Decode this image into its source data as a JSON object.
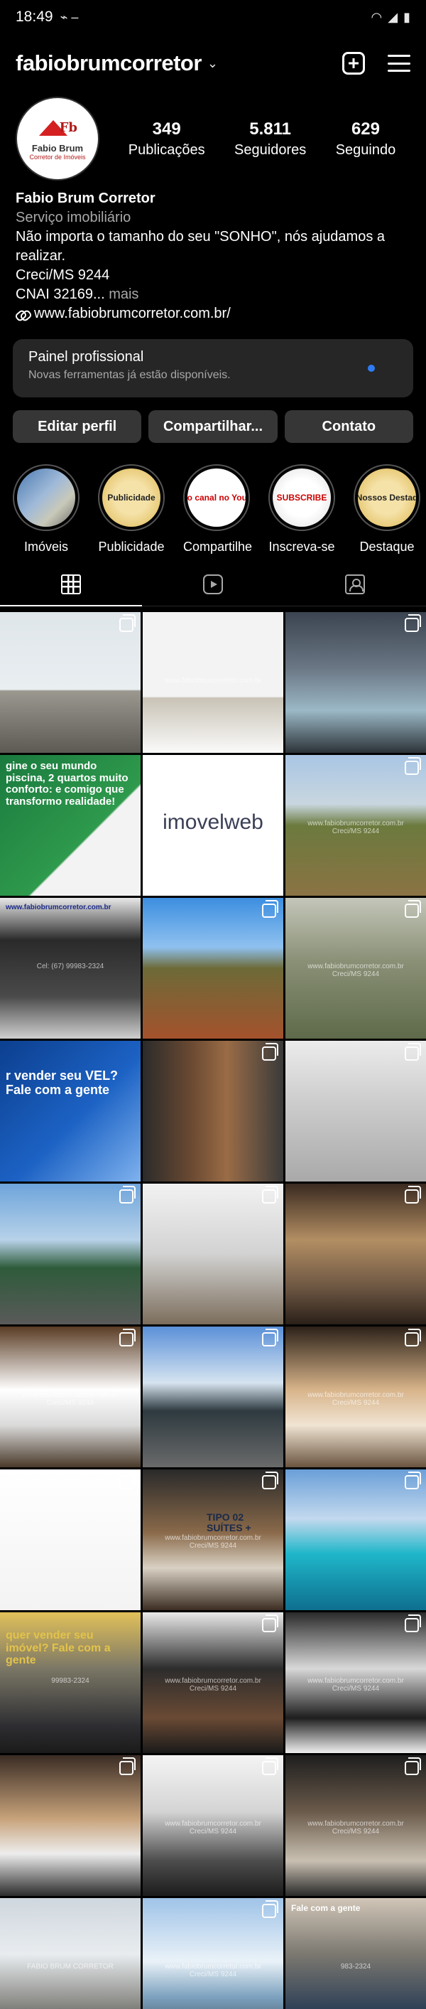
{
  "status_bar": {
    "time": "18:49",
    "indicators": "⌁ –",
    "signal": "wifi-signal-battery"
  },
  "header": {
    "username": "fabiobrumcorretor"
  },
  "profile": {
    "avatar_title": "Fabio Brum",
    "avatar_subtitle": "Corretor de Imóveis",
    "avatar_mark": "Fb",
    "stats": [
      {
        "value": "349",
        "label": "Publicações"
      },
      {
        "value": "5.811",
        "label": "Seguidores"
      },
      {
        "value": "629",
        "label": "Seguindo"
      }
    ]
  },
  "bio": {
    "name": "Fabio Brum Corretor",
    "category": "Serviço imobiliário",
    "line1": "Não importa o tamanho do seu \"SONHO\", nós ajudamos a",
    "line2": "realizar.",
    "line3": "Creci/MS 9244",
    "line4": "CNAI 32169...",
    "more": "mais",
    "website": "www.fabiobrumcorretor.com.br/"
  },
  "panel": {
    "title": "Painel profissional",
    "subtitle": "Novas ferramentas já estão disponíveis."
  },
  "buttons": {
    "edit": "Editar perfil",
    "share": "Compartilhar...",
    "contact": "Contato"
  },
  "highlights": [
    {
      "label": "Imóveis",
      "inner": ""
    },
    {
      "label": "Publicidade",
      "inner": "Publicidade"
    },
    {
      "label": "Compartilhe",
      "inner": "Nosso canal no YouTube"
    },
    {
      "label": "Inscreva-se",
      "inner": "SUBSCRIBE"
    },
    {
      "label": "Destaque",
      "inner": "Nossos Destaq"
    }
  ],
  "posts": [
    {
      "caption": "",
      "watermark": "",
      "multi": true
    },
    {
      "caption": "",
      "watermark": "www.fabiobrumcorretor.com.br",
      "multi": false
    },
    {
      "caption": "",
      "watermark": "",
      "multi": true
    },
    {
      "caption": "gine o seu mundo piscina, 2 quartos muito conforto: e comigo que transformo realidade!",
      "watermark": "",
      "multi": false
    },
    {
      "caption": "imovelweb",
      "watermark": "",
      "multi": true
    },
    {
      "caption": "",
      "watermark": "www.fabiobrumcorretor.com.br Creci/MS 9244",
      "multi": true
    },
    {
      "caption": "www.fabiobrumcorretor.com.br",
      "watermark": "Cel: (67) 99983-2324",
      "multi": false
    },
    {
      "caption": "",
      "watermark": "",
      "multi": true
    },
    {
      "caption": "",
      "watermark": "www.fabiobrumcorretor.com.br Creci/MS 9244",
      "multi": true
    },
    {
      "caption": "r vender seu VEL? Fale com a gente",
      "watermark": "",
      "multi": false
    },
    {
      "caption": "",
      "watermark": "",
      "multi": true
    },
    {
      "caption": "",
      "watermark": "",
      "multi": true
    },
    {
      "caption": "",
      "watermark": "",
      "multi": true
    },
    {
      "caption": "",
      "watermark": "",
      "multi": true
    },
    {
      "caption": "",
      "watermark": "",
      "multi": true
    },
    {
      "caption": "",
      "watermark": "www.fabiobrumcorretor.com.br Creci/MS 9244",
      "multi": true
    },
    {
      "caption": "",
      "watermark": "",
      "multi": true
    },
    {
      "caption": "",
      "watermark": "www.fabiobrumcorretor.com.br Creci/MS 9244",
      "multi": true
    },
    {
      "caption": "",
      "watermark": "",
      "multi": true
    },
    {
      "caption": "TIPO 02 SUÍTES +",
      "watermark": "www.fabiobrumcorretor.com.br Creci/MS 9244",
      "multi": true
    },
    {
      "caption": "",
      "watermark": "",
      "multi": true
    },
    {
      "caption": "quer vender seu imóvel? Fale com a gente",
      "watermark": "99983-2324",
      "multi": false
    },
    {
      "caption": "",
      "watermark": "www.fabiobrumcorretor.com.br Creci/MS 9244",
      "multi": true
    },
    {
      "caption": "",
      "watermark": "www.fabiobrumcorretor.com.br Creci/MS 9244",
      "multi": true
    },
    {
      "caption": "",
      "watermark": "",
      "multi": true
    },
    {
      "caption": "",
      "watermark": "www.fabiobrumcorretor.com.br Creci/MS 9244",
      "multi": true
    },
    {
      "caption": "",
      "watermark": "www.fabiobrumcorretor.com.br Creci/MS 9244",
      "multi": true
    },
    {
      "caption": "",
      "watermark": "FABIO BRUM CORRETOR",
      "multi": false
    },
    {
      "caption": "",
      "watermark": "www.fabiobrumcorretor.com.br Creci/MS 9244",
      "multi": true
    },
    {
      "caption": "Fale com a gente",
      "watermark": "983-2324",
      "multi": false
    }
  ]
}
